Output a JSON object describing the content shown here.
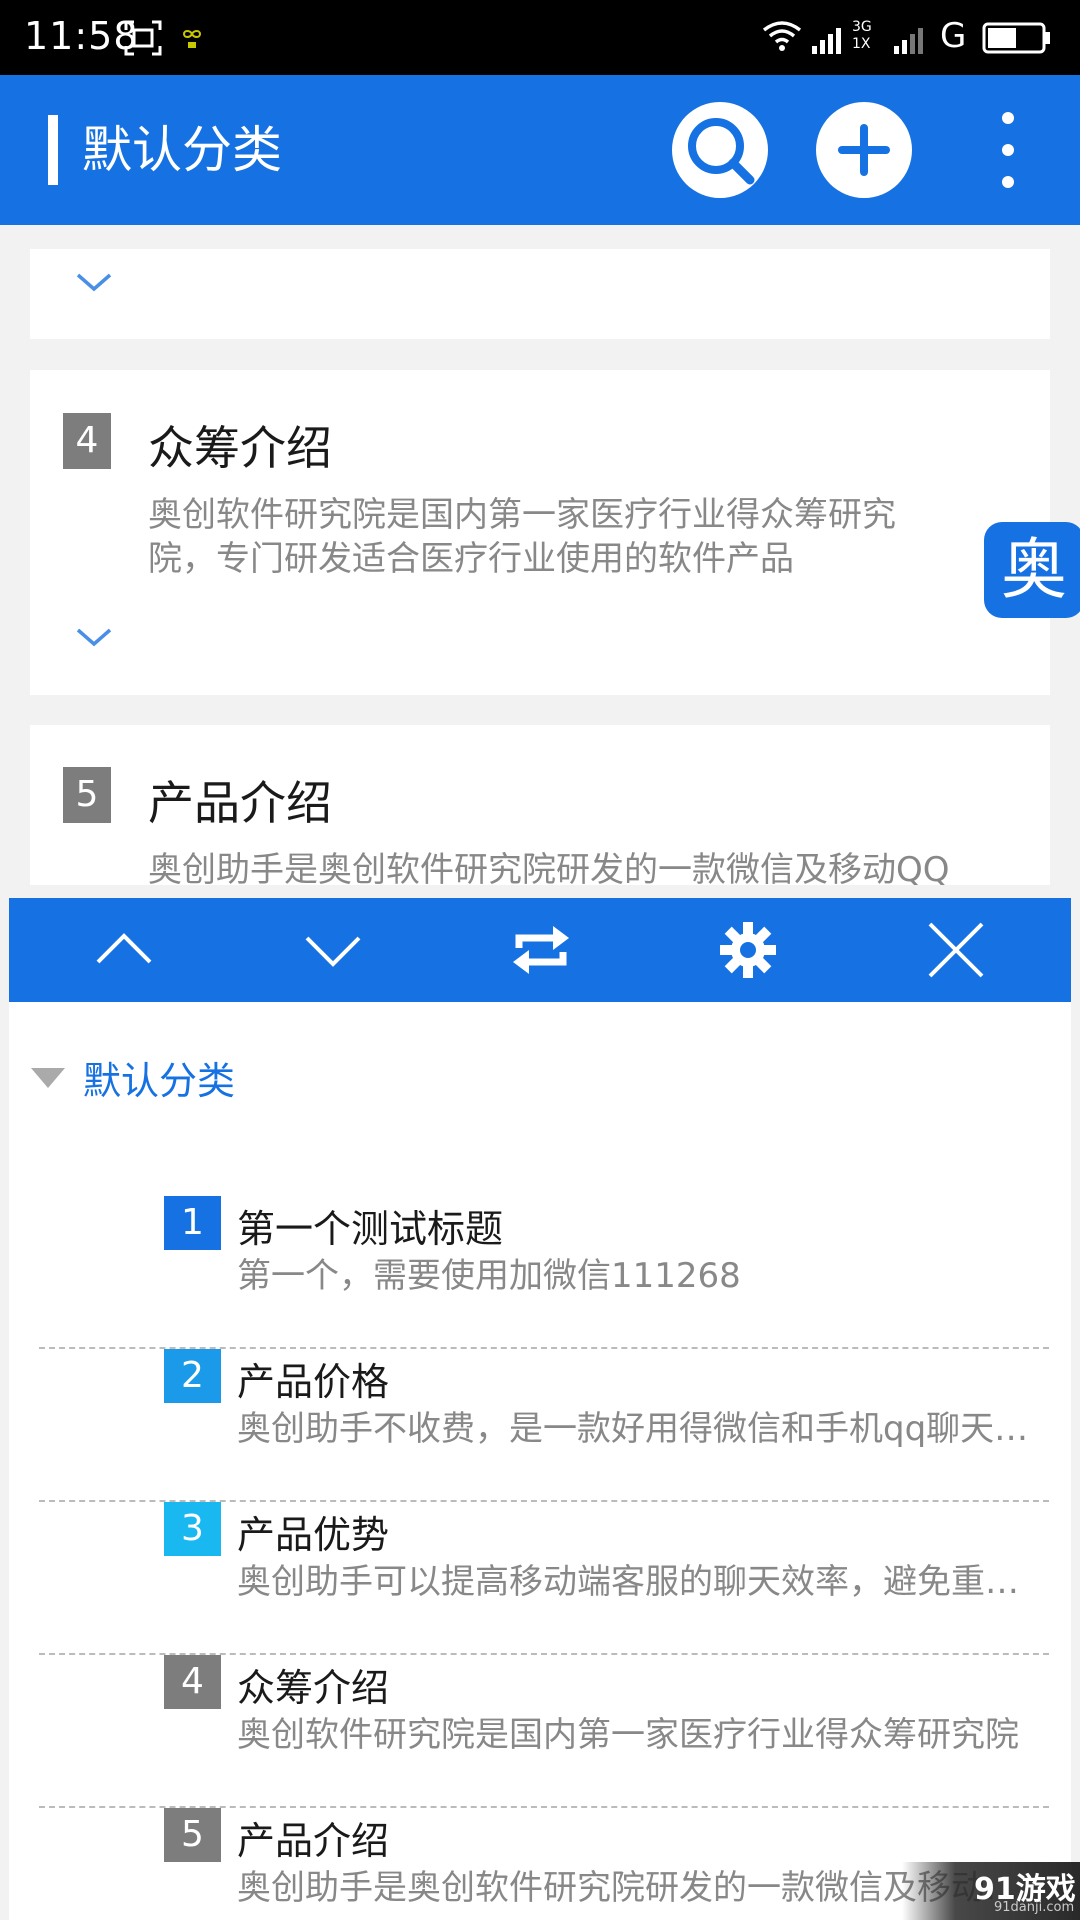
{
  "status_bar": {
    "time": "11:58",
    "network_top": "3G",
    "network_bottom": "1X",
    "carrier": "G",
    "icons": [
      "screenshot-icon",
      "infinity-icon",
      "wifi-icon",
      "signal-icon",
      "signal-icon",
      "battery-icon"
    ]
  },
  "app_bar": {
    "title": "默认分类",
    "icons": [
      "search-icon",
      "plus-icon",
      "more-vert-icon"
    ]
  },
  "cards": [
    {
      "number": "4",
      "title": "众筹介绍",
      "desc_line1": "奥创软件研究院是国内第一家医疗行业得众筹研究",
      "desc_line2": "院，专门研发适合医疗行业使用的软件产品"
    },
    {
      "number": "5",
      "title": "产品介绍",
      "desc_line1": "奥创助手是奥创软件研究院研发的一款微信及移动QQ"
    }
  ],
  "floating_button": {
    "label": "奥"
  },
  "toolbar": {
    "icons": [
      "chevron-up-icon",
      "chevron-down-icon",
      "swap-icon",
      "gear-icon",
      "close-icon"
    ]
  },
  "category": {
    "label": "默认分类"
  },
  "list_items": [
    {
      "number": "1",
      "title": "第一个测试标题",
      "desc": "第一个，需要使用加微信111268",
      "color": "#1672e2"
    },
    {
      "number": "2",
      "title": "产品价格",
      "desc": "奥创助手不收费，是一款好用得微信和手机qq聊天工具",
      "color": "#1a9ae8"
    },
    {
      "number": "3",
      "title": "产品优势",
      "desc": "奥创助手可以提高移动端客服的聊天效率，避免重复输入",
      "color": "#19b8f0"
    },
    {
      "number": "4",
      "title": "众筹介绍",
      "desc": "奥创软件研究院是国内第一家医疗行业得众筹研究院",
      "color": "#7d7d7d"
    },
    {
      "number": "5",
      "title": "产品介绍",
      "desc": "奥创助手是奥创软件研究院研发的一款微信及移动QQ",
      "color": "#7d7d7d"
    }
  ],
  "watermark": {
    "main": "91游戏",
    "sub": "91danji.com"
  },
  "colors": {
    "primary": "#1672e2",
    "gray_badge": "#7d7d7d"
  }
}
